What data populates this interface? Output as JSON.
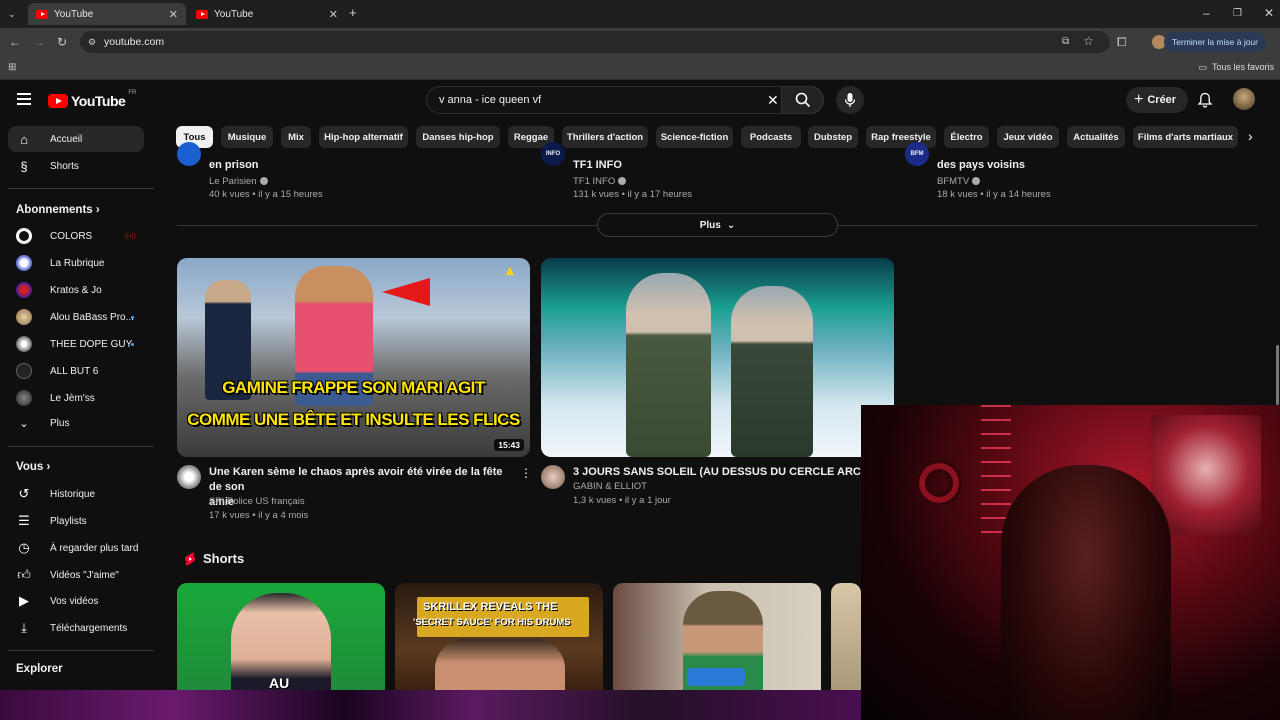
{
  "browser": {
    "tabs": [
      {
        "title": "YouTube",
        "active": true
      },
      {
        "title": "YouTube",
        "active": false
      }
    ],
    "url": "youtube.com",
    "update_button": "Terminer la mise à jour",
    "bookmarks_all": "Tous les favoris"
  },
  "header": {
    "logo_text": "YouTube",
    "logo_region": "FR",
    "search_value": "v anna - ice queen vf",
    "create_label": "Créer"
  },
  "sidebar": {
    "main": [
      {
        "label": "Accueil",
        "icon": "home-icon",
        "active": true
      },
      {
        "label": "Shorts",
        "icon": "shorts-icon",
        "active": false
      }
    ],
    "subscriptions_title": "Abonnements",
    "subscriptions": [
      {
        "label": "COLORS",
        "color": "#ffffff",
        "live": true,
        "dot": false
      },
      {
        "label": "La Rubrique",
        "color": "#6b7bd6",
        "live": false,
        "dot": false
      },
      {
        "label": "Kratos & Jo",
        "color": "#8a2be2",
        "live": false,
        "dot": false
      },
      {
        "label": "Alou BaBass Pro...",
        "color": "#d4b896",
        "live": false,
        "dot": true
      },
      {
        "label": "THEE DOPE GUY",
        "color": "#c8c8c8",
        "live": false,
        "dot": true
      },
      {
        "label": "ALL BUT 6",
        "color": "#555555",
        "live": false,
        "dot": false
      },
      {
        "label": "Le Jèm'ss",
        "color": "#444444",
        "live": false,
        "dot": false
      }
    ],
    "more_label": "Plus",
    "you_title": "Vous",
    "you_items": [
      {
        "label": "Historique",
        "icon": "history-icon"
      },
      {
        "label": "Playlists",
        "icon": "playlists-icon"
      },
      {
        "label": "À regarder plus tard",
        "icon": "watch-later-icon"
      },
      {
        "label": "Vidéos \"J'aime\"",
        "icon": "like-icon"
      },
      {
        "label": "Vos vidéos",
        "icon": "your-videos-icon"
      },
      {
        "label": "Téléchargements",
        "icon": "download-icon"
      }
    ],
    "explore_title": "Explorer"
  },
  "chips": [
    "Tous",
    "Musique",
    "Mix",
    "Hip-hop alternatif",
    "Danses hip-hop",
    "Reggae",
    "Thrillers d'action",
    "Science-fiction",
    "Podcasts",
    "Dubstep",
    "Rap freestyle",
    "Électro",
    "Jeux vidéo",
    "Actualités",
    "Films d'arts martiaux"
  ],
  "top_videos": [
    {
      "title_tail": "en prison",
      "channel": "Le Parisien",
      "meta": "40 k vues • il y a 15 heures"
    },
    {
      "title_tail": "TF1 INFO",
      "channel": "TF1 INFO",
      "meta": "131 k vues • il y a 17 heures",
      "badge": "INFO"
    },
    {
      "title_tail": "des pays voisins",
      "channel": "BFMTV",
      "meta": "18 k vues • il y a 14 heures",
      "badge": "BFM"
    }
  ],
  "plus_label": "Plus",
  "videos": [
    {
      "title_line1": "Une Karen sème le chaos après avoir été virée de la fête de son",
      "title_line2": "amie",
      "channel": "SPI Police US français",
      "meta": "17 k vues • il y a 4 mois",
      "duration": "15:43",
      "thumb_text1": "GAMINE FRAPPE SON MARI AGIT",
      "thumb_text2": "COMME UNE BÊTE ET INSULTE LES FLICS"
    },
    {
      "title_line1": "3 JOURS SANS SOLEIL (AU DESSUS DU CERCLE ARCTIQUE)",
      "channel": "GABIN & ELLIOT",
      "meta": "1,3 k vues • il y a 1 jour"
    }
  ],
  "shorts_title": "Shorts",
  "shorts": [
    {
      "overlay": "AU"
    },
    {
      "overlay1": "SKRILLEX REVEALS THE",
      "overlay2": "'SECRET SAUCE' FOR HIS DRUMS"
    },
    {},
    {}
  ]
}
